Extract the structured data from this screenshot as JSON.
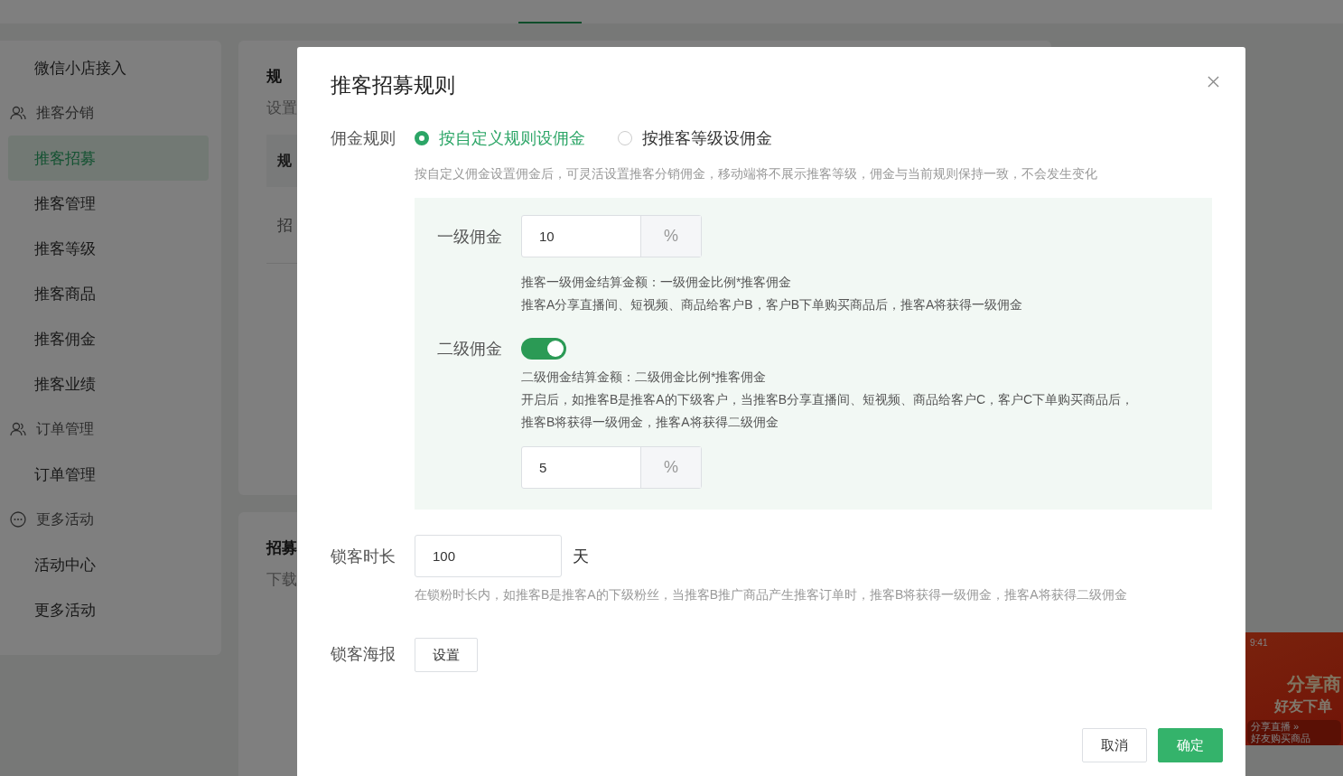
{
  "sidebar": [
    {
      "kind": "item",
      "label": "微信小店接入",
      "selected": false
    },
    {
      "kind": "people-group",
      "label": "推客分销",
      "selected": false
    },
    {
      "kind": "item",
      "label": "推客招募",
      "selected": true
    },
    {
      "kind": "item",
      "label": "推客管理",
      "selected": false
    },
    {
      "kind": "item",
      "label": "推客等级",
      "selected": false
    },
    {
      "kind": "item",
      "label": "推客商品",
      "selected": false
    },
    {
      "kind": "item",
      "label": "推客佣金",
      "selected": false
    },
    {
      "kind": "item",
      "label": "推客业绩",
      "selected": false
    },
    {
      "kind": "people-group",
      "label": "订单管理",
      "selected": false
    },
    {
      "kind": "item",
      "label": "订单管理",
      "selected": false
    },
    {
      "kind": "more-group",
      "label": "更多活动",
      "selected": false
    },
    {
      "kind": "item",
      "label": "活动中心",
      "selected": false
    },
    {
      "kind": "item",
      "label": "更多活动",
      "selected": false
    }
  ],
  "rules_card": {
    "title": "规",
    "subtitle": "设置",
    "table_header": "规",
    "table_cell": "招"
  },
  "recruit_card": {
    "title": "招募",
    "subtitle": "下载"
  },
  "poster_preview": {
    "time": "9:41",
    "headline": "分享商",
    "subline": "好友下单",
    "step_1": "分享直播",
    "arrow": "»",
    "step_2": "好友购买商品"
  },
  "dialog": {
    "title": "推客招募规则",
    "commission_rule": {
      "label": "佣金规则",
      "options": [
        {
          "label": "按自定义规则设佣金",
          "selected": true
        },
        {
          "label": "按推客等级设佣金",
          "selected": false
        }
      ],
      "hint": "按自定义佣金设置佣金后，可灵活设置推客分销佣金，移动端将不展示推客等级，佣金与当前规则保持一致，不会发生变化"
    },
    "level_1": {
      "label": "一级佣金",
      "value": "10",
      "unit": "%",
      "notes": [
        "推客一级佣金结算金额：一级佣金比例*推客佣金",
        "推客A分享直播间、短视频、商品给客户B，客户B下单购买商品后，推客A将获得一级佣金"
      ]
    },
    "level_2": {
      "label": "二级佣金",
      "on": true,
      "notes": [
        "二级佣金结算金额：二级佣金比例*推客佣金",
        "开启后，如推客B是推客A的下级客户，当推客B分享直播间、短视频、商品给客户C，客户C下单购买商品后，",
        "推客B将获得一级佣金，推客A将获得二级佣金"
      ],
      "value": "5",
      "unit": "%"
    },
    "lock_duration": {
      "label": "锁客时长",
      "value": "100",
      "unit": "天",
      "hint": "在锁粉时长内，如推客B是推客A的下级粉丝，当推客B推广商品产生推客订单时，推客B将获得一级佣金，推客A将获得二级佣金"
    },
    "lock_poster": {
      "label": "锁客海报",
      "button": "设置"
    },
    "cancel": "取消",
    "confirm": "确定"
  }
}
